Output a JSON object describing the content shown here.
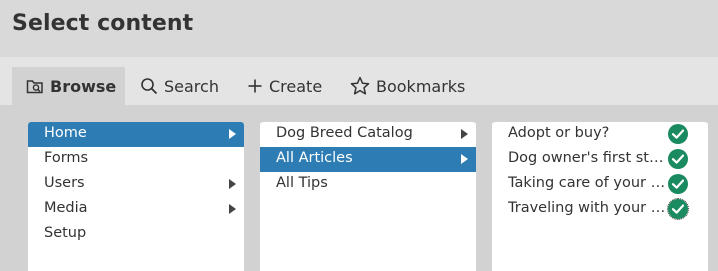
{
  "dialog": {
    "title": "Select content"
  },
  "tabs": [
    {
      "label": "Browse",
      "icon": "browse-icon",
      "active": true
    },
    {
      "label": "Search",
      "icon": "search-icon"
    },
    {
      "label": "Create",
      "icon": "plus-icon"
    },
    {
      "label": "Bookmarks",
      "icon": "star-icon"
    }
  ],
  "columns": {
    "sections": [
      {
        "label": "Home",
        "selected": true,
        "has_children": true
      },
      {
        "label": "Forms"
      },
      {
        "label": "Users",
        "has_children": true
      },
      {
        "label": "Media",
        "has_children": true
      },
      {
        "label": "Setup"
      }
    ],
    "folders": [
      {
        "label": "Dog Breed Catalog",
        "has_children": true
      },
      {
        "label": "All Articles",
        "selected": true,
        "has_children": true
      },
      {
        "label": "All Tips"
      }
    ],
    "articles": [
      {
        "label": "Adopt or buy?",
        "checked": true
      },
      {
        "label": "Dog owner's first steps",
        "checked": true
      },
      {
        "label": "Taking care of your dog",
        "checked": true
      },
      {
        "label": "Traveling with your dog",
        "checked": true
      }
    ]
  },
  "colors": {
    "accent": "#2d7cb3",
    "check": "#1a8a60"
  }
}
